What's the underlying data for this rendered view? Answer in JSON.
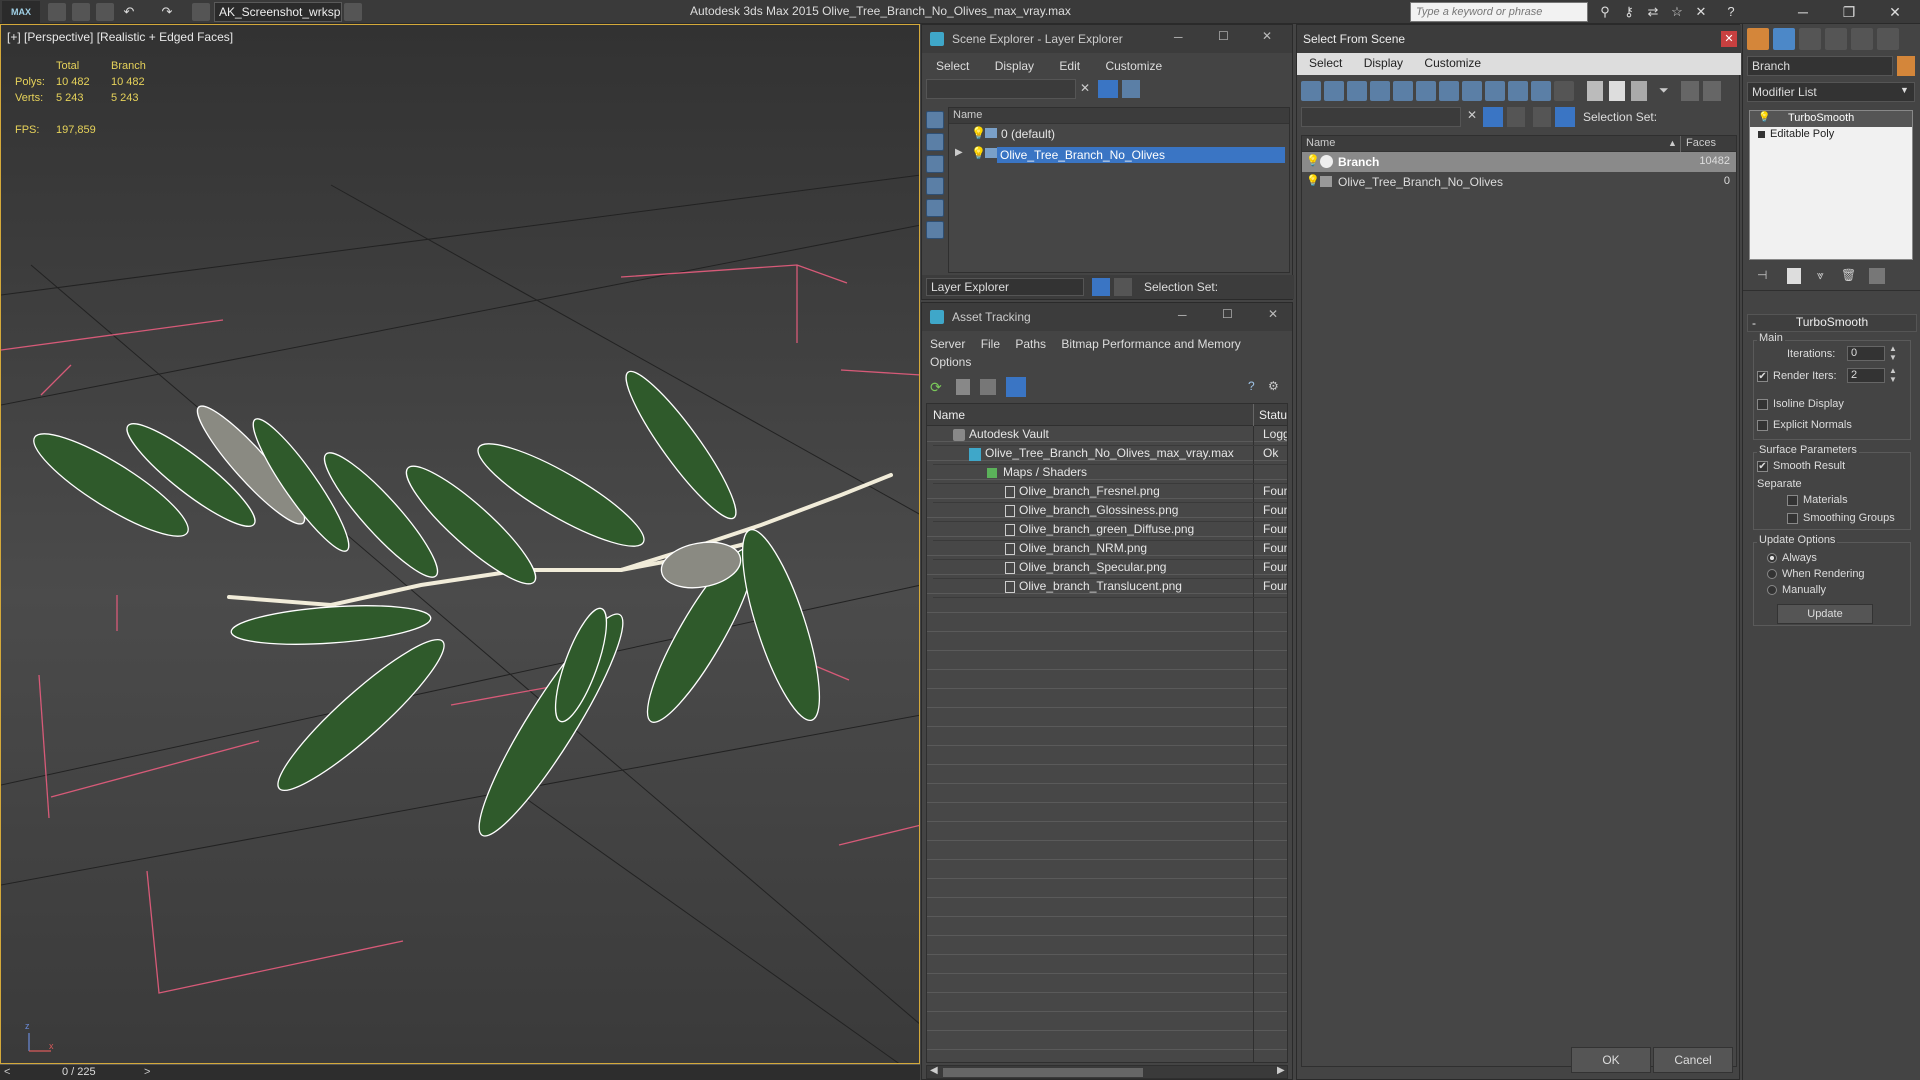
{
  "titlebar": {
    "logo": "MAX",
    "workspace": "AK_Screenshot_wrksp",
    "app_title": "Autodesk 3ds Max  2015     Olive_Tree_Branch_No_Olives_max_vray.max",
    "search_placeholder": "Type a keyword or phrase"
  },
  "viewport": {
    "label": "[+] [Perspective] [Realistic + Edged Faces]",
    "stats": {
      "col_total": "Total",
      "col_branch": "Branch",
      "polys_label": "Polys:",
      "polys_total": "10 482",
      "polys_branch": "10 482",
      "verts_label": "Verts:",
      "verts_total": "5 243",
      "verts_branch": "5 243",
      "fps_label": "FPS:",
      "fps_value": "197,859"
    }
  },
  "timeline": {
    "frame": "0 / 225"
  },
  "scene_explorer": {
    "title": "Scene Explorer - Layer Explorer",
    "menu": [
      "Select",
      "Display",
      "Edit",
      "Customize"
    ],
    "col_name": "Name",
    "rows": [
      "0 (default)",
      "Olive_Tree_Branch_No_Olives"
    ],
    "footer_mode": "Layer Explorer",
    "selection_set_label": "Selection Set:"
  },
  "asset_tracking": {
    "title": "Asset Tracking",
    "menu": [
      "Server",
      "File",
      "Paths",
      "Bitmap Performance and Memory",
      "Options"
    ],
    "col_name": "Name",
    "col_status": "Status",
    "rows": [
      {
        "name": "Autodesk Vault",
        "status": "Logge"
      },
      {
        "name": "Olive_Tree_Branch_No_Olives_max_vray.max",
        "status": "Ok"
      },
      {
        "name": "Maps / Shaders",
        "status": ""
      },
      {
        "name": "Olive_branch_Fresnel.png",
        "status": "Found"
      },
      {
        "name": "Olive_branch_Glossiness.png",
        "status": "Found"
      },
      {
        "name": "Olive_branch_green_Diffuse.png",
        "status": "Found"
      },
      {
        "name": "Olive_branch_NRM.png",
        "status": "Found"
      },
      {
        "name": "Olive_branch_Specular.png",
        "status": "Found"
      },
      {
        "name": "Olive_branch_Translucent.png",
        "status": "Found"
      }
    ]
  },
  "select_from_scene": {
    "title": "Select From Scene",
    "menu": [
      "Select",
      "Display",
      "Customize"
    ],
    "selection_set_label": "Selection Set:",
    "col_name": "Name",
    "col_faces": "Faces",
    "rows": [
      {
        "name": "Branch",
        "faces": "10482"
      },
      {
        "name": "Olive_Tree_Branch_No_Olives",
        "faces": "0"
      }
    ],
    "ok": "OK",
    "cancel": "Cancel"
  },
  "command_panel": {
    "object_name": "Branch",
    "modifier_list": "Modifier List",
    "stack": [
      "TurboSmooth",
      "Editable Poly"
    ],
    "rollout_title": "TurboSmooth",
    "main_label": "Main",
    "iterations_label": "Iterations:",
    "iterations_value": "0",
    "render_iters_label": "Render Iters:",
    "render_iters_value": "2",
    "isoline": "Isoline Display",
    "explicit_normals": "Explicit Normals",
    "surface_params": "Surface Parameters",
    "smooth_result": "Smooth Result",
    "separate": "Separate",
    "materials": "Materials",
    "smoothing_groups": "Smoothing Groups",
    "update_options": "Update Options",
    "always": "Always",
    "when_rendering": "When Rendering",
    "manually": "Manually",
    "update_button": "Update"
  },
  "colors": {
    "accent_blue": "#3a75c4",
    "viewport_border": "#d4a93a",
    "stats_yellow": "#e6d25a"
  }
}
